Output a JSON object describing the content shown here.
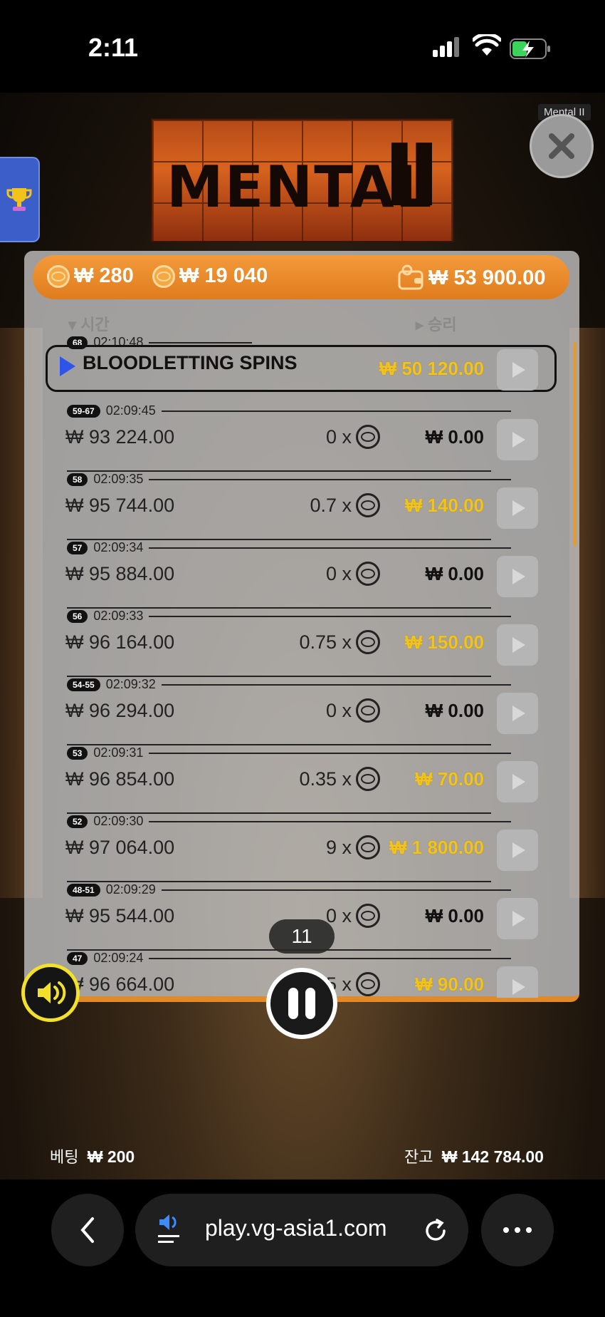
{
  "status_bar": {
    "time": "2:11"
  },
  "game": {
    "logo_text": "MENTAL",
    "tooltip": "Mental II",
    "top_bar": {
      "coin_value": "₩ 280",
      "coin_total": "₩ 19 040",
      "wallet": "₩ 53 900.00"
    },
    "headers": {
      "time": "시간",
      "win": "승리"
    },
    "featured": {
      "badge": "68",
      "time": "02:10:48",
      "label": "BLOODLETTING SPINS",
      "win": "₩ 50 120.00"
    },
    "rows": [
      {
        "badge": "59-67",
        "time": "02:09:45",
        "balance": "₩ 93 224.00",
        "mult": "0 x",
        "win": "₩ 0.00",
        "positive": false
      },
      {
        "badge": "58",
        "time": "02:09:35",
        "balance": "₩ 95 744.00",
        "mult": "0.7 x",
        "win": "₩ 140.00",
        "positive": true
      },
      {
        "badge": "57",
        "time": "02:09:34",
        "balance": "₩ 95 884.00",
        "mult": "0 x",
        "win": "₩ 0.00",
        "positive": false
      },
      {
        "badge": "56",
        "time": "02:09:33",
        "balance": "₩ 96 164.00",
        "mult": "0.75 x",
        "win": "₩ 150.00",
        "positive": true
      },
      {
        "badge": "54-55",
        "time": "02:09:32",
        "balance": "₩ 96 294.00",
        "mult": "0 x",
        "win": "₩ 0.00",
        "positive": false
      },
      {
        "badge": "53",
        "time": "02:09:31",
        "balance": "₩ 96 854.00",
        "mult": "0.35 x",
        "win": "₩ 70.00",
        "positive": true
      },
      {
        "badge": "52",
        "time": "02:09:30",
        "balance": "₩ 97 064.00",
        "mult": "9 x",
        "win": "₩ 1 800.00",
        "positive": true
      },
      {
        "badge": "48-51",
        "time": "02:09:29",
        "balance": "₩ 95 544.00",
        "mult": "0 x",
        "win": "₩ 0.00",
        "positive": false
      },
      {
        "badge": "47",
        "time": "02:09:24",
        "balance": "₩ 96 664.00",
        "mult": "0.45 x",
        "win": "₩ 90.00",
        "positive": true
      }
    ],
    "spin_count": "11",
    "footer": {
      "bet_label": "베팅",
      "bet_value": "₩ 200",
      "balance_label": "잔고",
      "balance_value": "₩ 142 784.00"
    }
  },
  "browser": {
    "url": "play.vg-asia1.com"
  },
  "colors": {
    "accent_orange": "#e88a2a",
    "win_yellow": "#f2c31a",
    "play_blue": "#2e55e8"
  }
}
